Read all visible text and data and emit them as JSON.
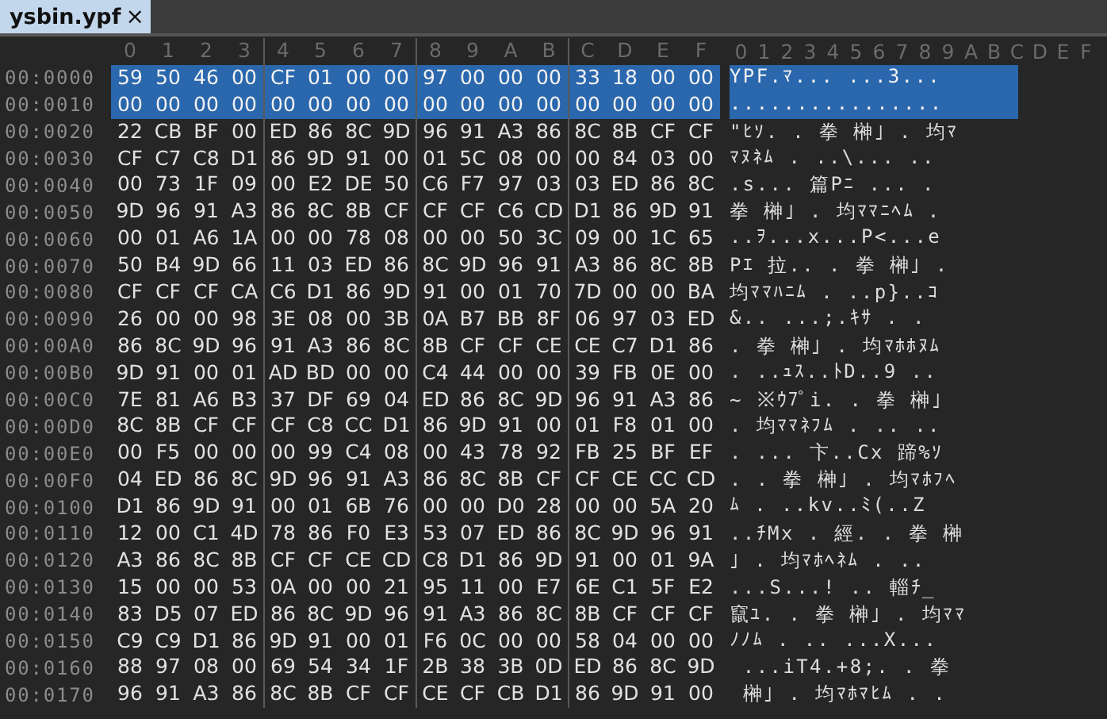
{
  "tab": {
    "title": "ysbin.ypf",
    "close": "×",
    "selected": true
  },
  "hex_columns": [
    "0",
    "1",
    "2",
    "3",
    "4",
    "5",
    "6",
    "7",
    "8",
    "9",
    "A",
    "B",
    "C",
    "D",
    "E",
    "F"
  ],
  "text_columns": [
    "0",
    "1",
    "2",
    "3",
    "4",
    "5",
    "6",
    "7",
    "8",
    "9",
    "A",
    "B",
    "C",
    "D",
    "E",
    "F"
  ],
  "rows": [
    {
      "address": "00:0000",
      "bytes": [
        "59",
        "50",
        "46",
        "00",
        "CF",
        "01",
        "00",
        "00",
        "97",
        "00",
        "00",
        "00",
        "33",
        "18",
        "00",
        "00"
      ],
      "text": "YPF.ﾏ... ...3...",
      "selected": true
    },
    {
      "address": "00:0010",
      "bytes": [
        "00",
        "00",
        "00",
        "00",
        "00",
        "00",
        "00",
        "00",
        "00",
        "00",
        "00",
        "00",
        "00",
        "00",
        "00",
        "00"
      ],
      "text": "................",
      "selected": true
    },
    {
      "address": "00:0020",
      "bytes": [
        "22",
        "CB",
        "BF",
        "00",
        "ED",
        "86",
        "8C",
        "9D",
        "96",
        "91",
        "A3",
        "86",
        "8C",
        "8B",
        "CF",
        "CF"
      ],
      "text": "\"ﾋｿ. . 拳 榊｣ . 均ﾏ",
      "selected": false
    },
    {
      "address": "00:0030",
      "bytes": [
        "CF",
        "C7",
        "C8",
        "D1",
        "86",
        "9D",
        "91",
        "00",
        "01",
        "5C",
        "08",
        "00",
        "00",
        "84",
        "03",
        "00"
      ],
      "text": "ﾏﾇﾈﾑ . ..\\... ..",
      "selected": false
    },
    {
      "address": "00:0040",
      "bytes": [
        "00",
        "73",
        "1F",
        "09",
        "00",
        "E2",
        "DE",
        "50",
        "C6",
        "F7",
        "97",
        "03",
        "03",
        "ED",
        "86",
        "8C"
      ],
      "text": ".s... 篇Pﾆ ... .",
      "selected": false
    },
    {
      "address": "00:0050",
      "bytes": [
        "9D",
        "96",
        "91",
        "A3",
        "86",
        "8C",
        "8B",
        "CF",
        "CF",
        "CF",
        "C6",
        "CD",
        "D1",
        "86",
        "9D",
        "91"
      ],
      "text": "拳 榊｣ . 均ﾏﾏﾆﾍﾑ .",
      "selected": false
    },
    {
      "address": "00:0060",
      "bytes": [
        "00",
        "01",
        "A6",
        "1A",
        "00",
        "00",
        "78",
        "08",
        "00",
        "00",
        "50",
        "3C",
        "09",
        "00",
        "1C",
        "65"
      ],
      "text": "..ｦ...x...P<...e",
      "selected": false
    },
    {
      "address": "00:0070",
      "bytes": [
        "50",
        "B4",
        "9D",
        "66",
        "11",
        "03",
        "ED",
        "86",
        "8C",
        "9D",
        "96",
        "91",
        "A3",
        "86",
        "8C",
        "8B"
      ],
      "text": "Pｴ 拉.. . 拳 榊｣ .",
      "selected": false
    },
    {
      "address": "00:0080",
      "bytes": [
        "CF",
        "CF",
        "CF",
        "CA",
        "C6",
        "D1",
        "86",
        "9D",
        "91",
        "00",
        "01",
        "70",
        "7D",
        "00",
        "00",
        "BA"
      ],
      "text": "均ﾏﾏﾊﾆﾑ . ..p}..ｺ",
      "selected": false
    },
    {
      "address": "00:0090",
      "bytes": [
        "26",
        "00",
        "00",
        "98",
        "3E",
        "08",
        "00",
        "3B",
        "0A",
        "B7",
        "BB",
        "8F",
        "06",
        "97",
        "03",
        "ED"
      ],
      "text": "&.. ...;.ｷｻ . .",
      "selected": false
    },
    {
      "address": "00:00A0",
      "bytes": [
        "86",
        "8C",
        "9D",
        "96",
        "91",
        "A3",
        "86",
        "8C",
        "8B",
        "CF",
        "CF",
        "CE",
        "CE",
        "C7",
        "D1",
        "86"
      ],
      "text": ". 拳 榊｣ . 均ﾏﾎﾎﾇﾑ",
      "selected": false
    },
    {
      "address": "00:00B0",
      "bytes": [
        "9D",
        "91",
        "00",
        "01",
        "AD",
        "BD",
        "00",
        "00",
        "C4",
        "44",
        "00",
        "00",
        "39",
        "FB",
        "0E",
        "00"
      ],
      "text": ". ..ｭｽ..ﾄD..9 ..",
      "selected": false
    },
    {
      "address": "00:00C0",
      "bytes": [
        "7E",
        "81",
        "A6",
        "B3",
        "37",
        "DF",
        "69",
        "04",
        "ED",
        "86",
        "8C",
        "9D",
        "96",
        "91",
        "A3",
        "86"
      ],
      "text": "~ ※ｳ7ﾟi. . 拳 榊｣",
      "selected": false
    },
    {
      "address": "00:00D0",
      "bytes": [
        "8C",
        "8B",
        "CF",
        "CF",
        "CF",
        "C8",
        "CC",
        "D1",
        "86",
        "9D",
        "91",
        "00",
        "01",
        "F8",
        "01",
        "00"
      ],
      "text": ". 均ﾏﾏﾈﾌﾑ . .. ..",
      "selected": false
    },
    {
      "address": "00:00E0",
      "bytes": [
        "00",
        "F5",
        "00",
        "00",
        "00",
        "99",
        "C4",
        "08",
        "00",
        "43",
        "78",
        "92",
        "FB",
        "25",
        "BF",
        "EF"
      ],
      "text": ". ... 卞..Cx 蹄%ｿ",
      "selected": false
    },
    {
      "address": "00:00F0",
      "bytes": [
        "04",
        "ED",
        "86",
        "8C",
        "9D",
        "96",
        "91",
        "A3",
        "86",
        "8C",
        "8B",
        "CF",
        "CF",
        "CE",
        "CC",
        "CD"
      ],
      "text": ". . 拳 榊｣ . 均ﾏﾎﾌﾍ",
      "selected": false
    },
    {
      "address": "00:0100",
      "bytes": [
        "D1",
        "86",
        "9D",
        "91",
        "00",
        "01",
        "6B",
        "76",
        "00",
        "00",
        "D0",
        "28",
        "00",
        "00",
        "5A",
        "20"
      ],
      "text": "ﾑ . ..kv..ﾐ(..Z",
      "selected": false
    },
    {
      "address": "00:0110",
      "bytes": [
        "12",
        "00",
        "C1",
        "4D",
        "78",
        "86",
        "F0",
        "E3",
        "53",
        "07",
        "ED",
        "86",
        "8C",
        "9D",
        "96",
        "91"
      ],
      "text": "..ﾁMx . 經. . 拳 榊",
      "selected": false
    },
    {
      "address": "00:0120",
      "bytes": [
        "A3",
        "86",
        "8C",
        "8B",
        "CF",
        "CF",
        "CE",
        "CD",
        "C8",
        "D1",
        "86",
        "9D",
        "91",
        "00",
        "01",
        "9A"
      ],
      "text": "｣ . 均ﾏﾎﾍﾈﾑ . ..",
      "selected": false
    },
    {
      "address": "00:0130",
      "bytes": [
        "15",
        "00",
        "00",
        "53",
        "0A",
        "00",
        "00",
        "21",
        "95",
        "11",
        "00",
        "E7",
        "6E",
        "C1",
        "5F",
        "E2"
      ],
      "text": "...S...! .. 輜ﾁ_",
      "selected": false
    },
    {
      "address": "00:0140",
      "bytes": [
        "83",
        "D5",
        "07",
        "ED",
        "86",
        "8C",
        "9D",
        "96",
        "91",
        "A3",
        "86",
        "8C",
        "8B",
        "CF",
        "CF",
        "CF"
      ],
      "text": "竄ﾕ. . 拳 榊｣ . 均ﾏﾏ",
      "selected": false
    },
    {
      "address": "00:0150",
      "bytes": [
        "C9",
        "C9",
        "D1",
        "86",
        "9D",
        "91",
        "00",
        "01",
        "F6",
        "0C",
        "00",
        "00",
        "58",
        "04",
        "00",
        "00"
      ],
      "text": "ﾉﾉﾑ . .. ...X...",
      "selected": false
    },
    {
      "address": "00:0160",
      "bytes": [
        "88",
        "97",
        "08",
        "00",
        "69",
        "54",
        "34",
        "1F",
        "2B",
        "38",
        "3B",
        "0D",
        "ED",
        "86",
        "8C",
        "9D"
      ],
      "text": " ...iT4.+8;. . 拳",
      "selected": false
    },
    {
      "address": "00:0170",
      "bytes": [
        "96",
        "91",
        "A3",
        "86",
        "8C",
        "8B",
        "CF",
        "CF",
        "CE",
        "CF",
        "CB",
        "D1",
        "86",
        "9D",
        "91",
        "00"
      ],
      "text": " 榊｣ . 均ﾏﾎﾏﾋﾑ . .",
      "selected": false
    }
  ]
}
